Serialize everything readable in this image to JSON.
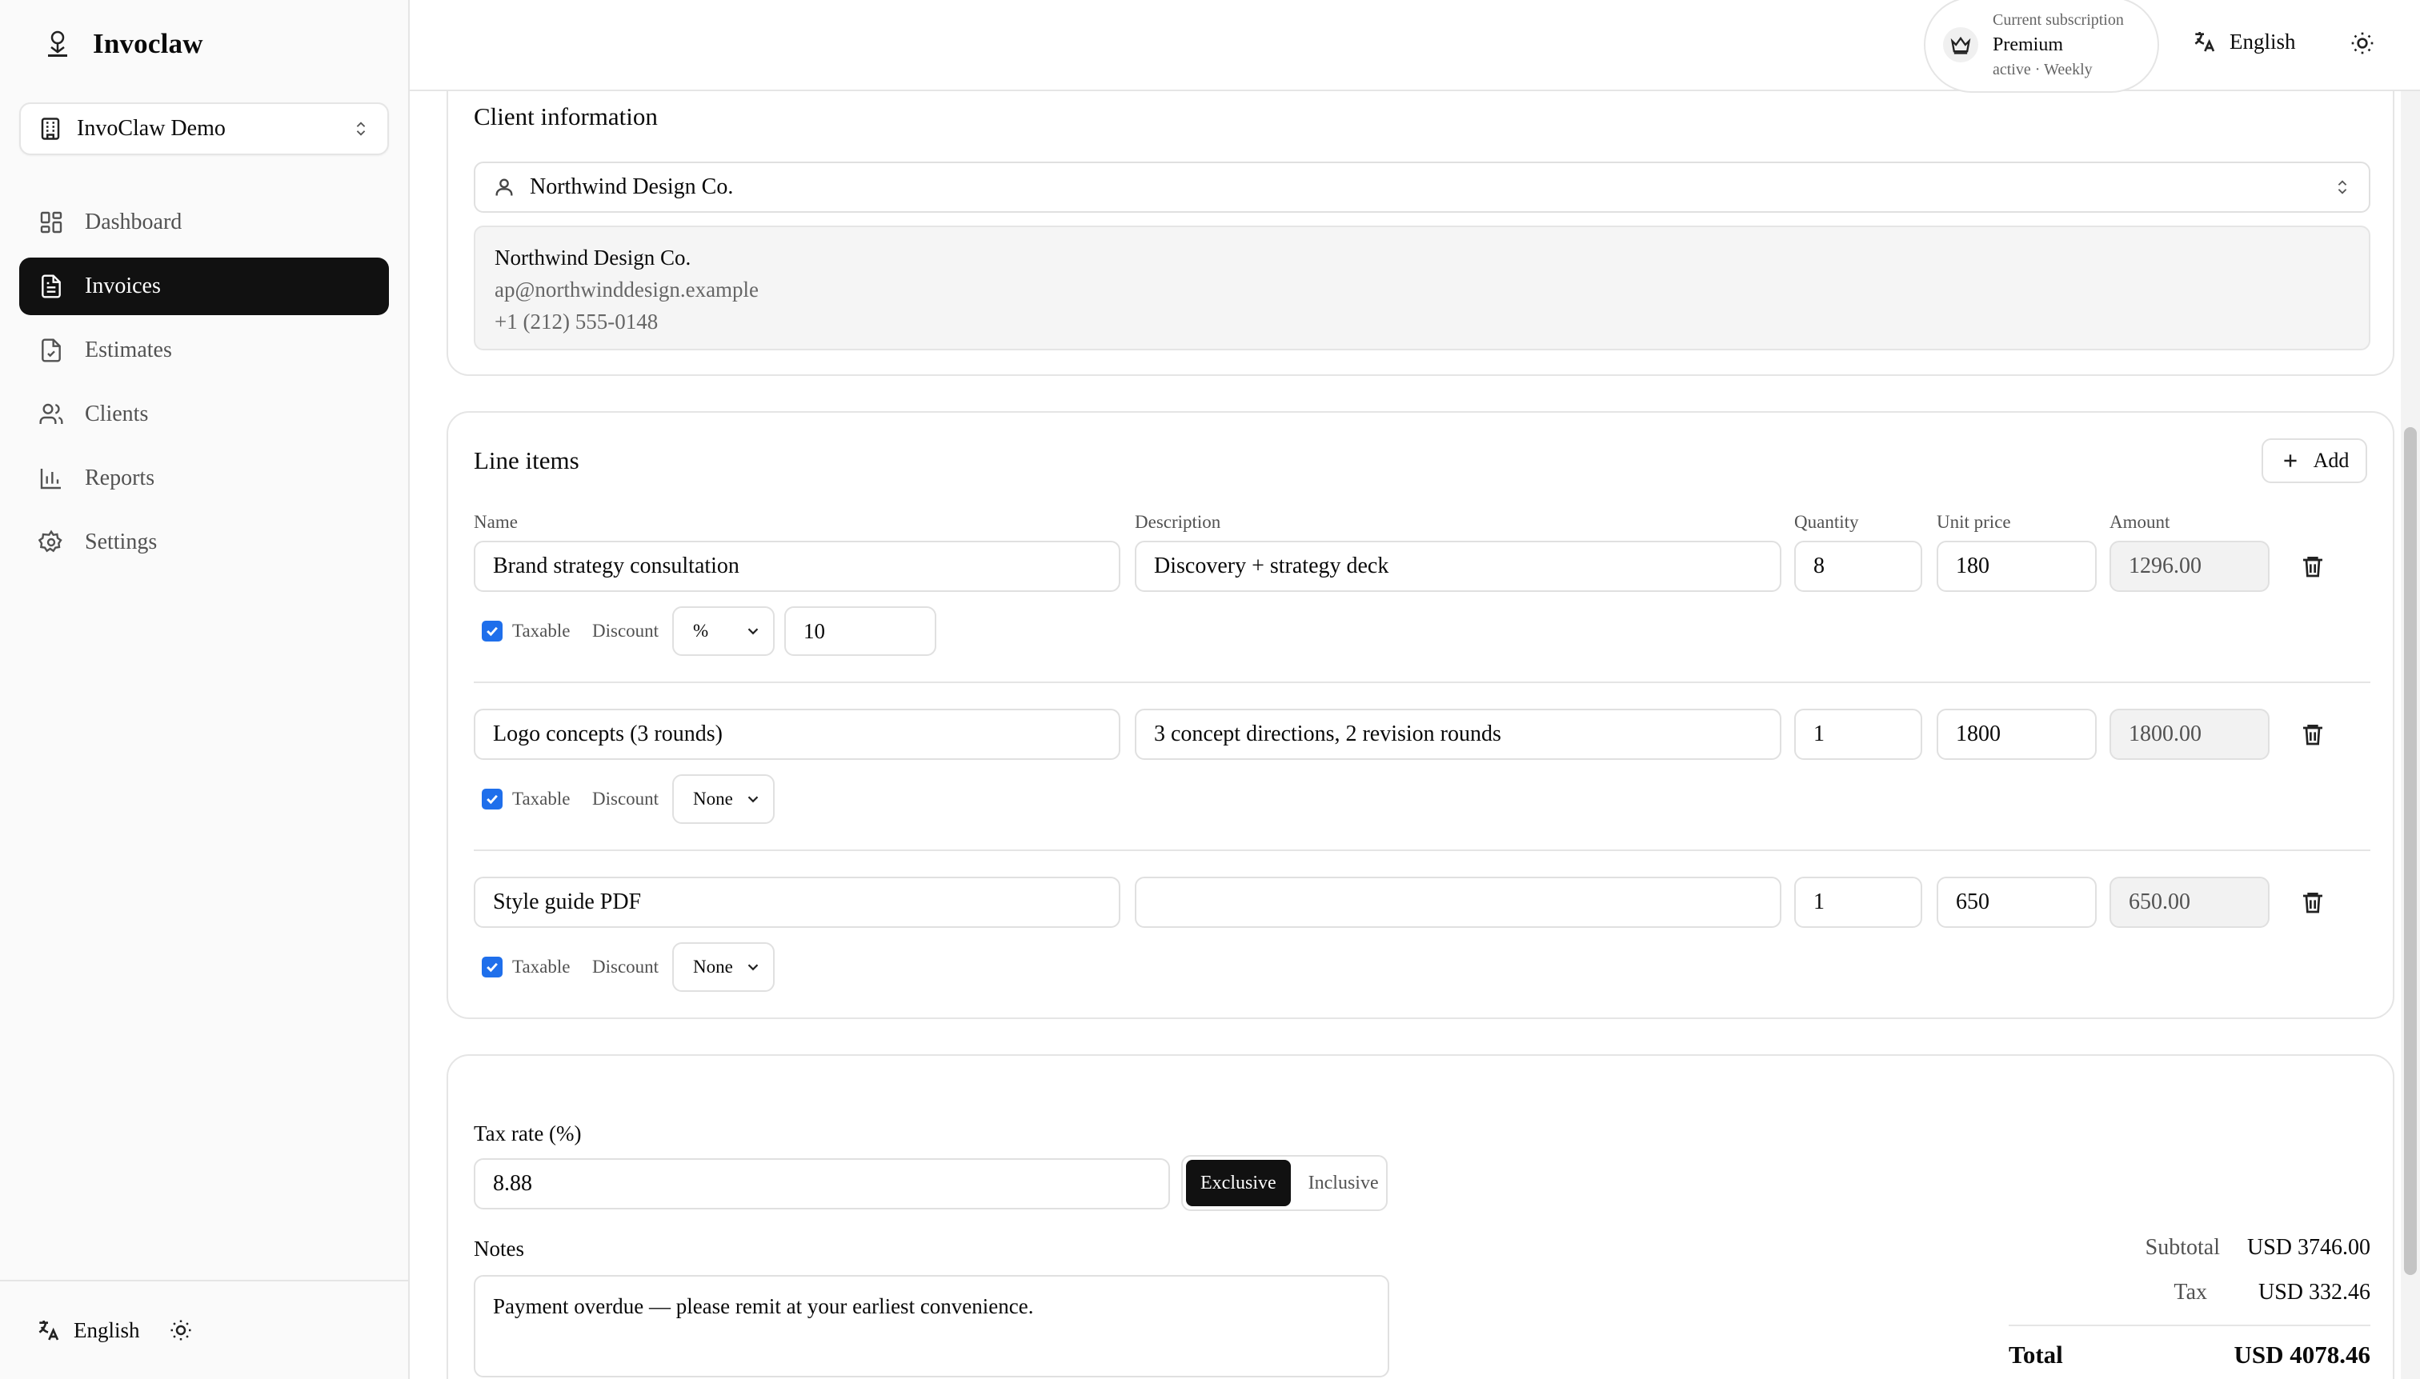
{
  "app": {
    "name": "Invoclaw"
  },
  "org_selector": {
    "label": "InvoClaw Demo"
  },
  "nav": {
    "items": [
      {
        "label": "Dashboard",
        "icon": "dashboard-icon"
      },
      {
        "label": "Invoices",
        "icon": "file-text-icon",
        "active": true
      },
      {
        "label": "Estimates",
        "icon": "file-check-icon"
      },
      {
        "label": "Clients",
        "icon": "users-icon"
      },
      {
        "label": "Reports",
        "icon": "bar-chart-icon"
      },
      {
        "label": "Settings",
        "icon": "gear-icon"
      }
    ]
  },
  "sidebar_footer": {
    "language": "English"
  },
  "topbar": {
    "subscription": {
      "caption": "Current subscription",
      "plan": "Premium",
      "status": "active · Weekly"
    },
    "language": "English"
  },
  "client_info": {
    "title": "Client information",
    "selected_client": "Northwind Design Co.",
    "details": {
      "name": "Northwind Design Co.",
      "email": "ap@northwinddesign.example",
      "phone": "+1 (212) 555-0148"
    }
  },
  "line_items": {
    "title": "Line items",
    "add_label": "Add",
    "headers": {
      "name": "Name",
      "description": "Description",
      "quantity": "Quantity",
      "unit_price": "Unit price",
      "amount": "Amount"
    },
    "taxable_label": "Taxable",
    "discount_label": "Discount",
    "rows": [
      {
        "name": "Brand strategy consultation",
        "description": "Discovery + strategy deck",
        "quantity": "8",
        "unit_price": "180",
        "amount": "1296.00",
        "taxable": true,
        "discount_type": "%",
        "discount_value": "10"
      },
      {
        "name": "Logo concepts (3 rounds)",
        "description": "3 concept directions, 2 revision rounds",
        "quantity": "1",
        "unit_price": "1800",
        "amount": "1800.00",
        "taxable": true,
        "discount_type": "None"
      },
      {
        "name": "Style guide PDF",
        "description": "",
        "quantity": "1",
        "unit_price": "650",
        "amount": "650.00",
        "taxable": true,
        "discount_type": "None"
      }
    ]
  },
  "tax": {
    "label": "Tax rate (%)",
    "value": "8.88",
    "modes": {
      "exclusive": "Exclusive",
      "inclusive": "Inclusive"
    },
    "selected_mode": "Exclusive"
  },
  "notes": {
    "label": "Notes",
    "value": "Payment overdue — please remit at your earliest convenience."
  },
  "totals": {
    "subtotal_label": "Subtotal",
    "subtotal": "USD 3746.00",
    "tax_label": "Tax",
    "tax": "USD 332.46",
    "total_label": "Total",
    "total": "USD 4078.46"
  },
  "colors": {
    "accent": "#111111",
    "checkbox": "#1f6feb",
    "border": "#e5e5e5"
  }
}
